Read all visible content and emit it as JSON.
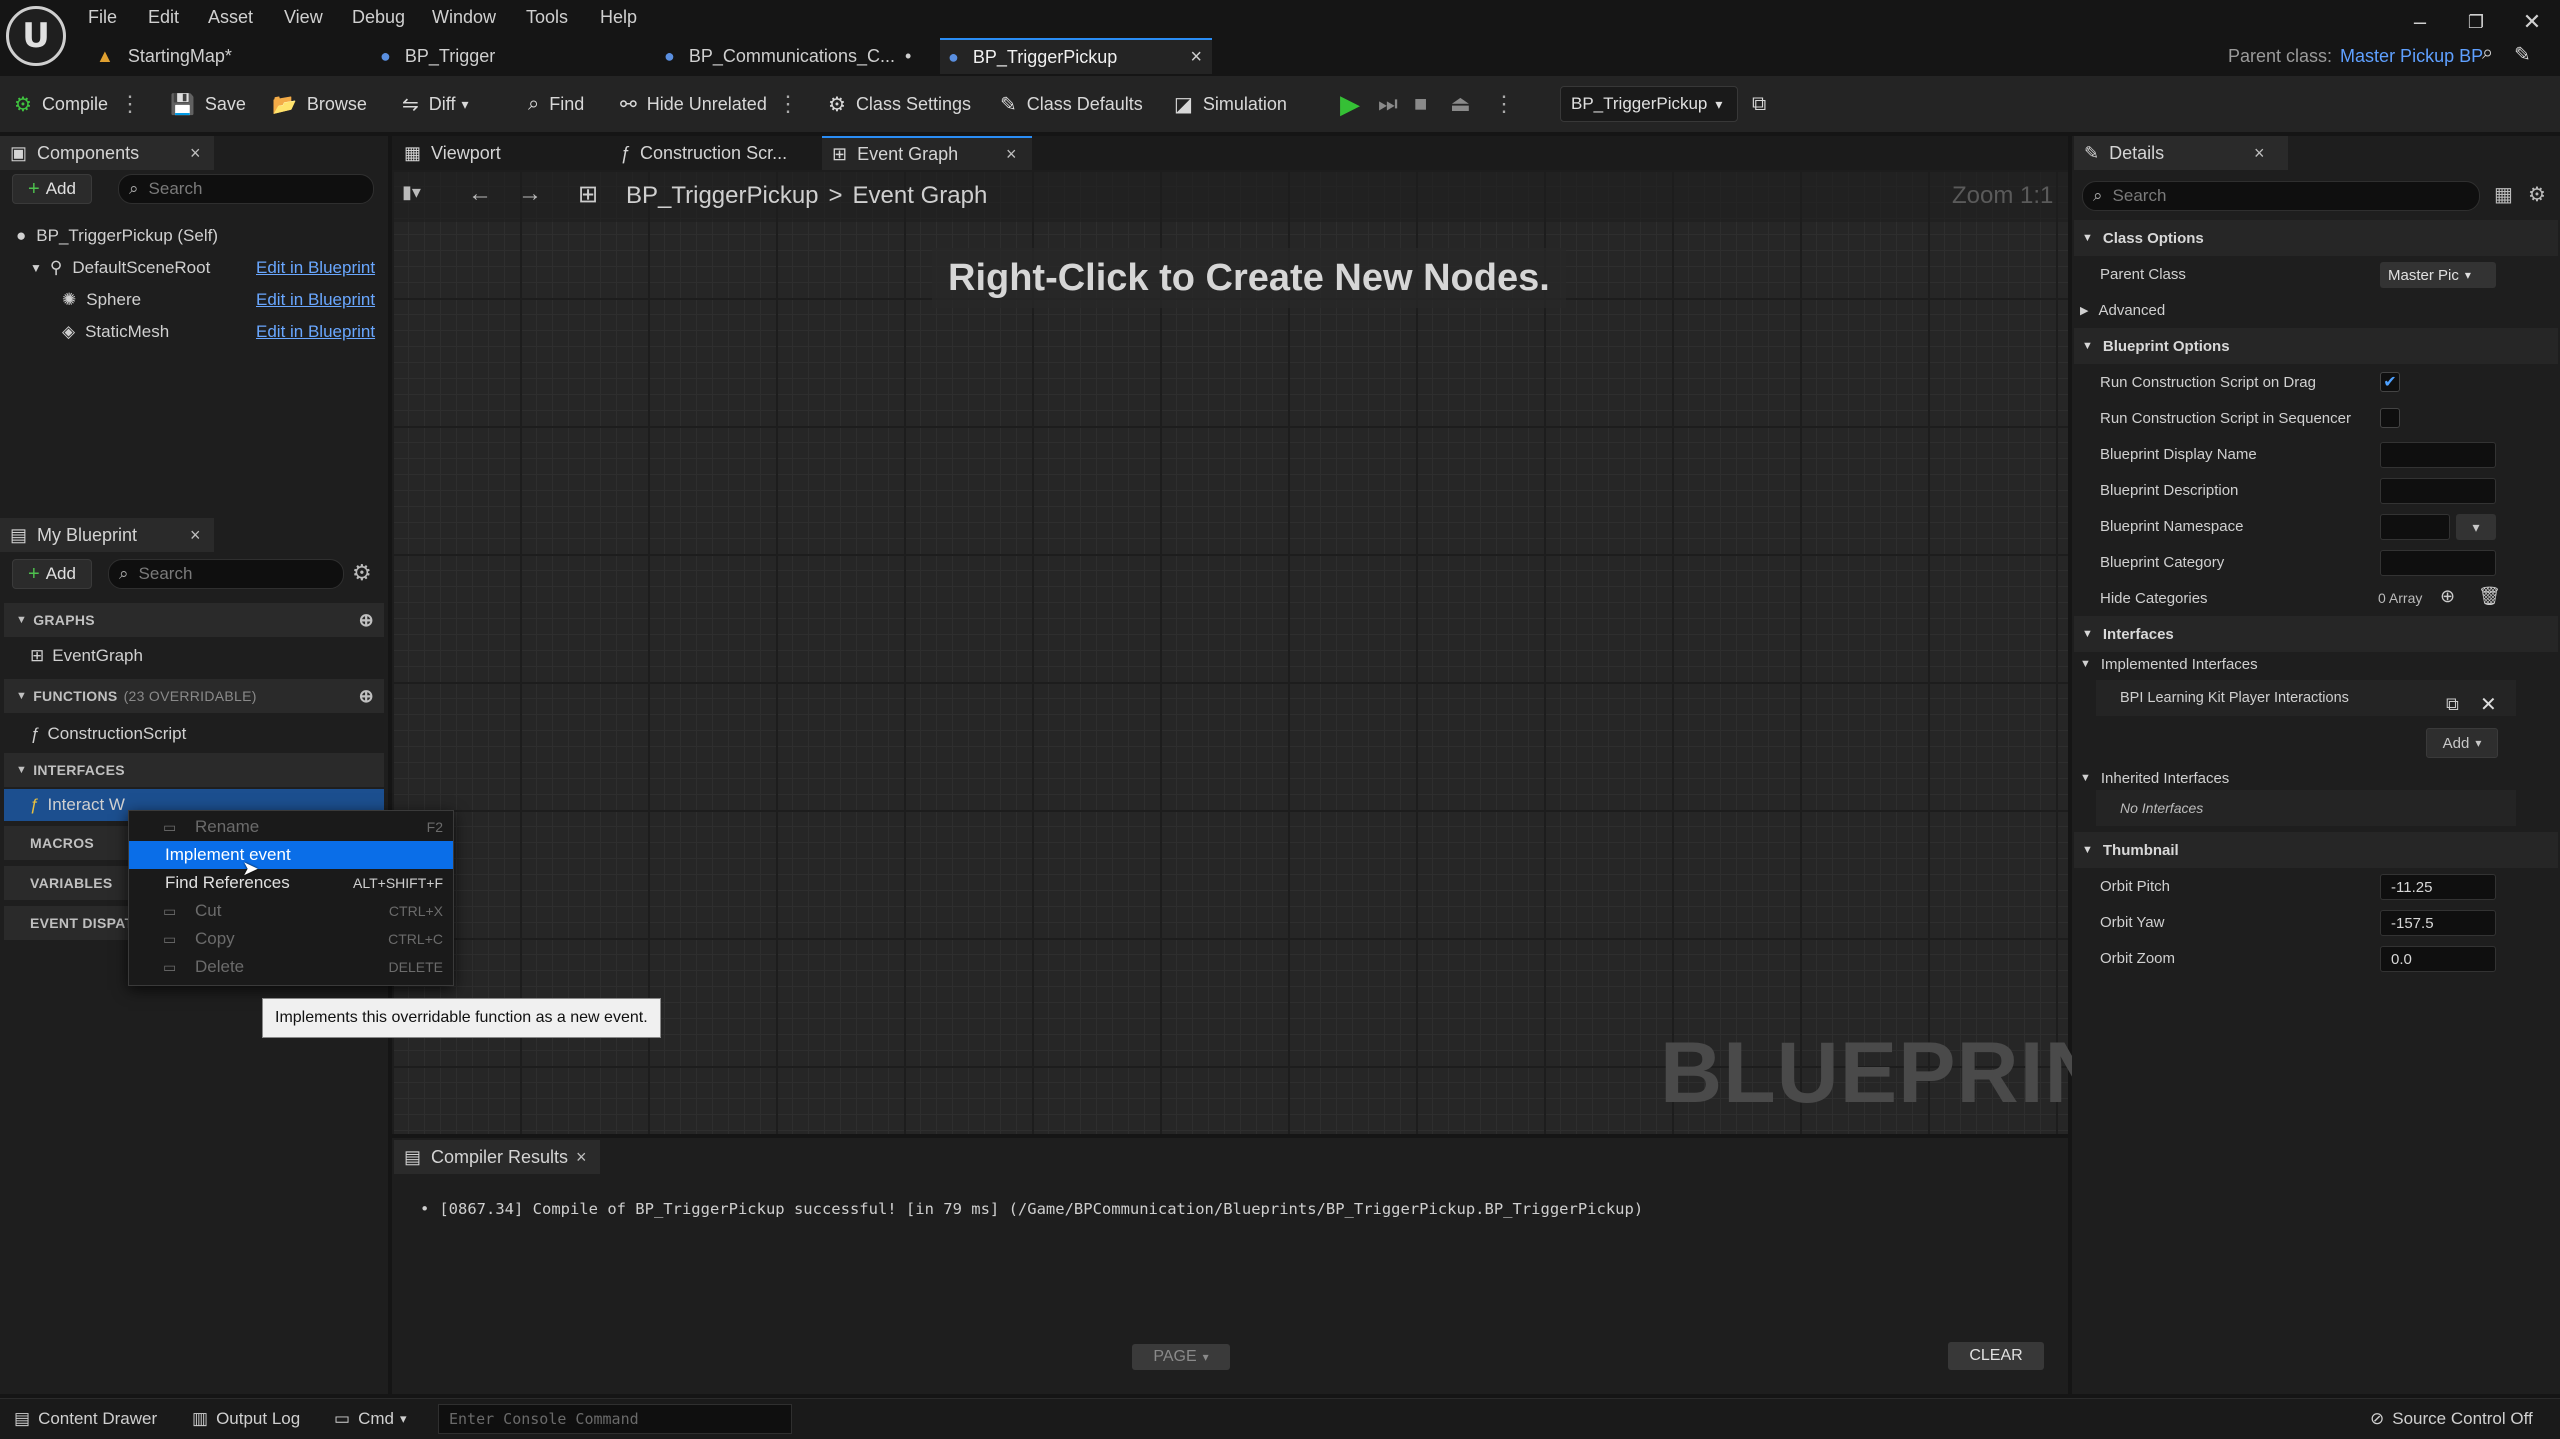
{
  "menu": [
    "File",
    "Edit",
    "Asset",
    "View",
    "Debug",
    "Window",
    "Tools",
    "Help"
  ],
  "tabs": [
    {
      "label": "StartingMap*",
      "icon": "level-icon"
    },
    {
      "label": "BP_Trigger",
      "icon": "blueprint-icon"
    },
    {
      "label": "BP_Communications_C...",
      "icon": "blueprint-icon",
      "modified": "•"
    },
    {
      "label": "BP_TriggerPickup",
      "icon": "blueprint-icon",
      "close": "×"
    }
  ],
  "parent_class": {
    "label": "Parent class:",
    "value": "Master Pickup BP"
  },
  "toolbar": {
    "compile": "Compile",
    "save": "Save",
    "browse": "Browse",
    "diff": "Diff",
    "find": "Find",
    "hide_unrelated": "Hide Unrelated",
    "class_settings": "Class Settings",
    "class_defaults": "Class Defaults",
    "simulation": "Simulation",
    "debug_object": "BP_TriggerPickup"
  },
  "components_panel": {
    "tab": "Components",
    "add": "Add",
    "search_placeholder": "Search",
    "items": [
      {
        "label": "BP_TriggerPickup (Self)",
        "link": ""
      },
      {
        "label": "DefaultSceneRoot",
        "link": "Edit in Blueprint"
      },
      {
        "label": "Sphere",
        "link": "Edit in Blueprint"
      },
      {
        "label": "StaticMesh",
        "link": "Edit in Blueprint"
      }
    ]
  },
  "my_blueprint": {
    "tab": "My Blueprint",
    "add": "Add",
    "search_placeholder": "Search",
    "graphs_header": "GRAPHS",
    "event_graph": "EventGraph",
    "functions_header": "FUNCTIONS",
    "functions_count": "(23 OVERRIDABLE)",
    "construction_script": "ConstructionScript",
    "interfaces_header": "INTERFACES",
    "interface_item": "Interact W",
    "macros_header": "MACROS",
    "variables_header": "VARIABLES",
    "event_dispatchers_header": "EVENT DISPATC"
  },
  "graph_tabs": [
    {
      "label": "Viewport"
    },
    {
      "label": "Construction Scr..."
    },
    {
      "label": "Event Graph",
      "close": "×"
    }
  ],
  "graph": {
    "breadcrumb_root": "BP_TriggerPickup",
    "breadcrumb_sep": ">",
    "breadcrumb_leaf": "Event Graph",
    "zoom": "Zoom 1:1",
    "hint": "Right-Click to Create New Nodes.",
    "watermark": "BLUEPRINT"
  },
  "context_menu": {
    "items": [
      {
        "label": "Rename",
        "shortcut": "F2",
        "disabled": true
      },
      {
        "label": "Implement event",
        "shortcut": "",
        "highlighted": true
      },
      {
        "label": "Find References",
        "shortcut": "ALT+SHIFT+F"
      },
      {
        "label": "Cut",
        "shortcut": "CTRL+X",
        "disabled": true
      },
      {
        "label": "Copy",
        "shortcut": "CTRL+C",
        "disabled": true
      },
      {
        "label": "Delete",
        "shortcut": "DELETE",
        "disabled": true
      }
    ],
    "tooltip": "Implements this overridable function as a new event."
  },
  "compiler": {
    "tab": "Compiler Results",
    "message": "[0867.34] Compile of BP_TriggerPickup successful! [in 79 ms] (/Game/BPCommunication/Blueprints/BP_TriggerPickup.BP_TriggerPickup)",
    "page": "PAGE",
    "clear": "CLEAR"
  },
  "details": {
    "tab": "Details",
    "search_placeholder": "Search",
    "class_options": "Class Options",
    "parent_class_label": "Parent Class",
    "parent_class_value": "Master Pic",
    "advanced": "Advanced",
    "blueprint_options": "Blueprint Options",
    "run_cs_drag": "Run Construction Script on Drag",
    "run_cs_drag_checked": true,
    "run_cs_seq": "Run Construction Script in Sequencer",
    "display_name": "Blueprint Display Name",
    "description": "Blueprint Description",
    "namespace": "Blueprint Namespace",
    "category": "Blueprint Category",
    "hide_categories": "Hide Categories",
    "hide_categories_value": "0 Array",
    "interfaces": "Interfaces",
    "implemented_interfaces": "Implemented Interfaces",
    "interface_name": "BPI Learning Kit Player Interactions",
    "add": "Add",
    "inherited_interfaces": "Inherited Interfaces",
    "no_interfaces": "No Interfaces",
    "thumbnail": "Thumbnail",
    "orbit_pitch": "Orbit Pitch",
    "orbit_pitch_value": "-11.25",
    "orbit_yaw": "Orbit Yaw",
    "orbit_yaw_value": "-157.5",
    "orbit_zoom": "Orbit Zoom",
    "orbit_zoom_value": "0.0"
  },
  "statusbar": {
    "content_drawer": "Content Drawer",
    "output_log": "Output Log",
    "cmd": "Cmd",
    "console_placeholder": "Enter Console Command",
    "source_control": "Source Control Off"
  },
  "colors": {
    "accent": "#2a8df5",
    "selection": "#0a6ee8",
    "link": "#69a7ff",
    "play": "#35c035"
  }
}
